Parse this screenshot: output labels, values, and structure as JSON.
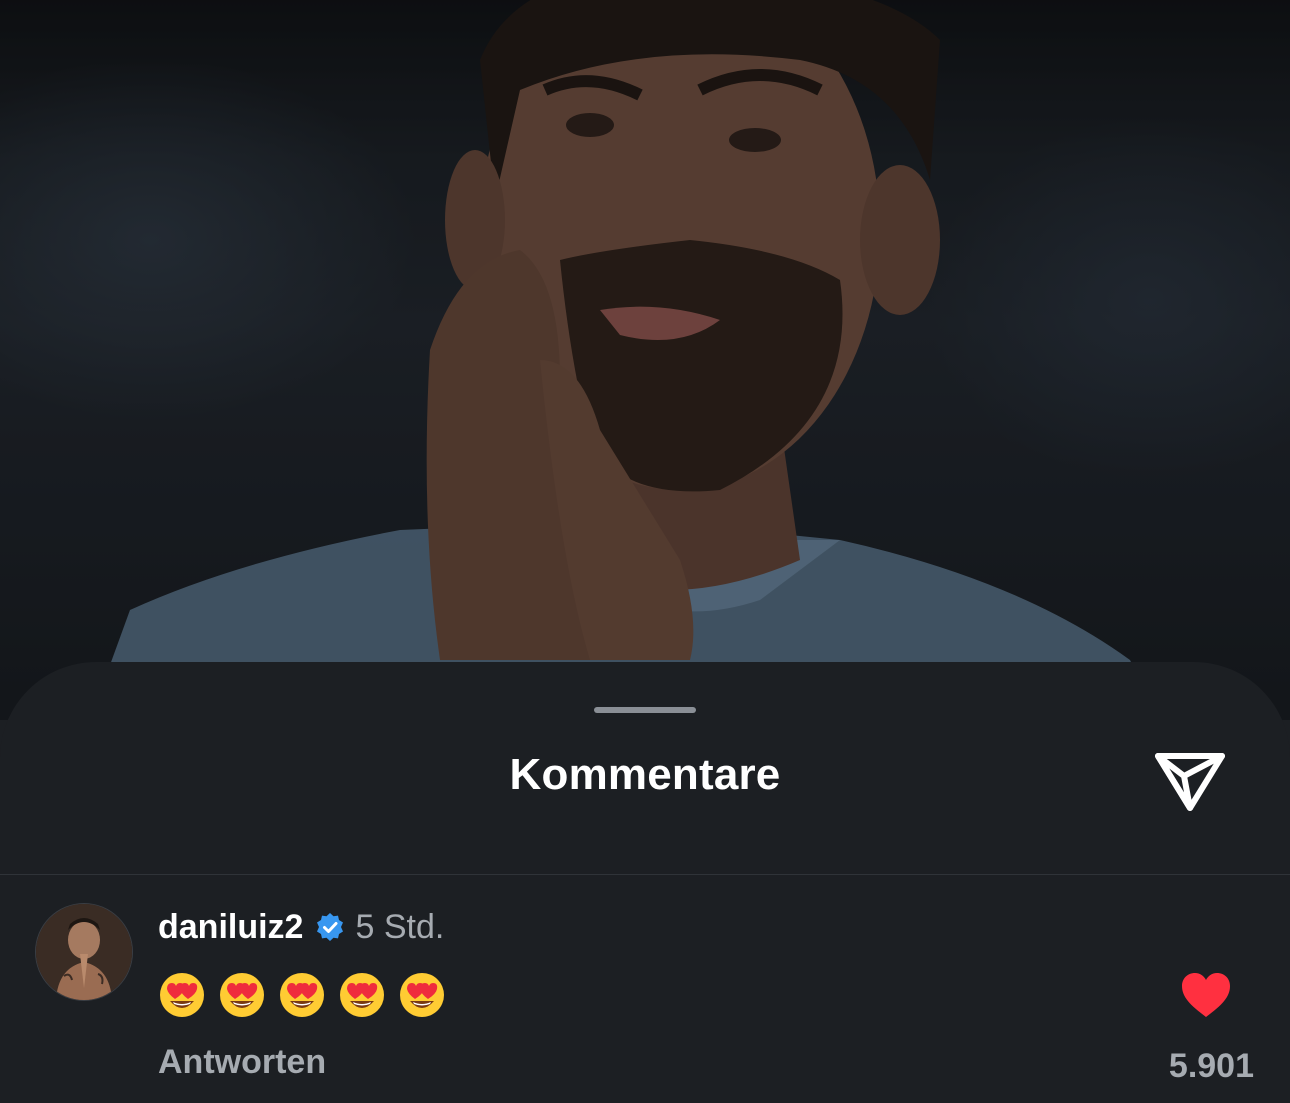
{
  "sheet": {
    "title": "Kommentare"
  },
  "icons": {
    "share": "paper-plane-icon",
    "verified": "verified-badge-icon",
    "like": "heart-icon",
    "emoji": "heart-eyes-emoji"
  },
  "comment": {
    "username": "daniluiz2",
    "time": "5 Std.",
    "emojis": [
      "😍",
      "😍",
      "😍",
      "😍",
      "😍"
    ],
    "reply_label": "Antworten",
    "like_count": "5.901",
    "liked": true
  },
  "colors": {
    "sheet_bg": "#1c1f23",
    "text_primary": "#ffffff",
    "text_secondary": "#a6abb1",
    "like_red": "#ff3040",
    "verified_blue": "#3897f0"
  }
}
